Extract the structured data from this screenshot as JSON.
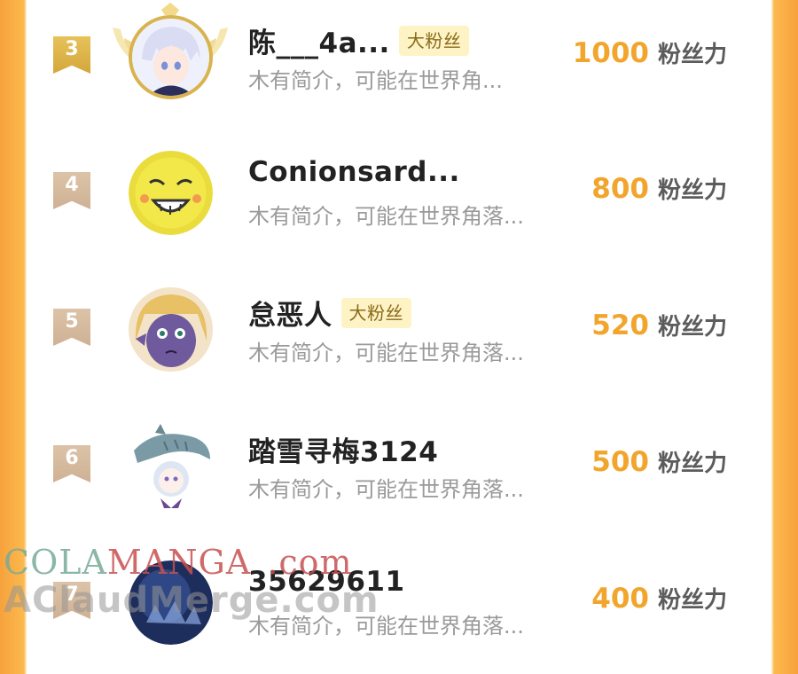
{
  "rows": [
    {
      "rank": "3",
      "name": "陈___4a...",
      "badge": "大粉丝",
      "bio": "木有简介，可能在世界角...",
      "score": "1000",
      "unit": "粉丝力",
      "avatar_icon": "anime-boy-white-hair-avatar"
    },
    {
      "rank": "4",
      "name": "Conionsard...",
      "badge": "",
      "bio": "木有简介，可能在世界角落...",
      "score": "800",
      "unit": "粉丝力",
      "avatar_icon": "yellow-laughing-face-avatar"
    },
    {
      "rank": "5",
      "name": "怠恶人",
      "badge": "大粉丝",
      "bio": "木有简介，可能在世界角落...",
      "score": "520",
      "unit": "粉丝力",
      "avatar_icon": "anime-elf-purple-face-avatar"
    },
    {
      "rank": "6",
      "name": "踏雪寻梅3124",
      "badge": "",
      "bio": "木有简介，可能在世界角落...",
      "score": "500",
      "unit": "粉丝力",
      "avatar_icon": "shark-hood-girl-avatar"
    },
    {
      "rank": "7",
      "name": "35629611",
      "badge": "",
      "bio": "木有简介，可能在世界角落...",
      "score": "400",
      "unit": "粉丝力",
      "avatar_icon": "dark-fantasy-avatar"
    }
  ],
  "watermark": {
    "line1a": "COLA",
    "line1b": "MANGA",
    "line1c": ".com",
    "line2": "AClaudMerge.com"
  },
  "colors": {
    "accent": "#f2a52c",
    "side": "#f7a23c",
    "gold_rank": "#d4a63a",
    "rank": "#cfb194"
  }
}
